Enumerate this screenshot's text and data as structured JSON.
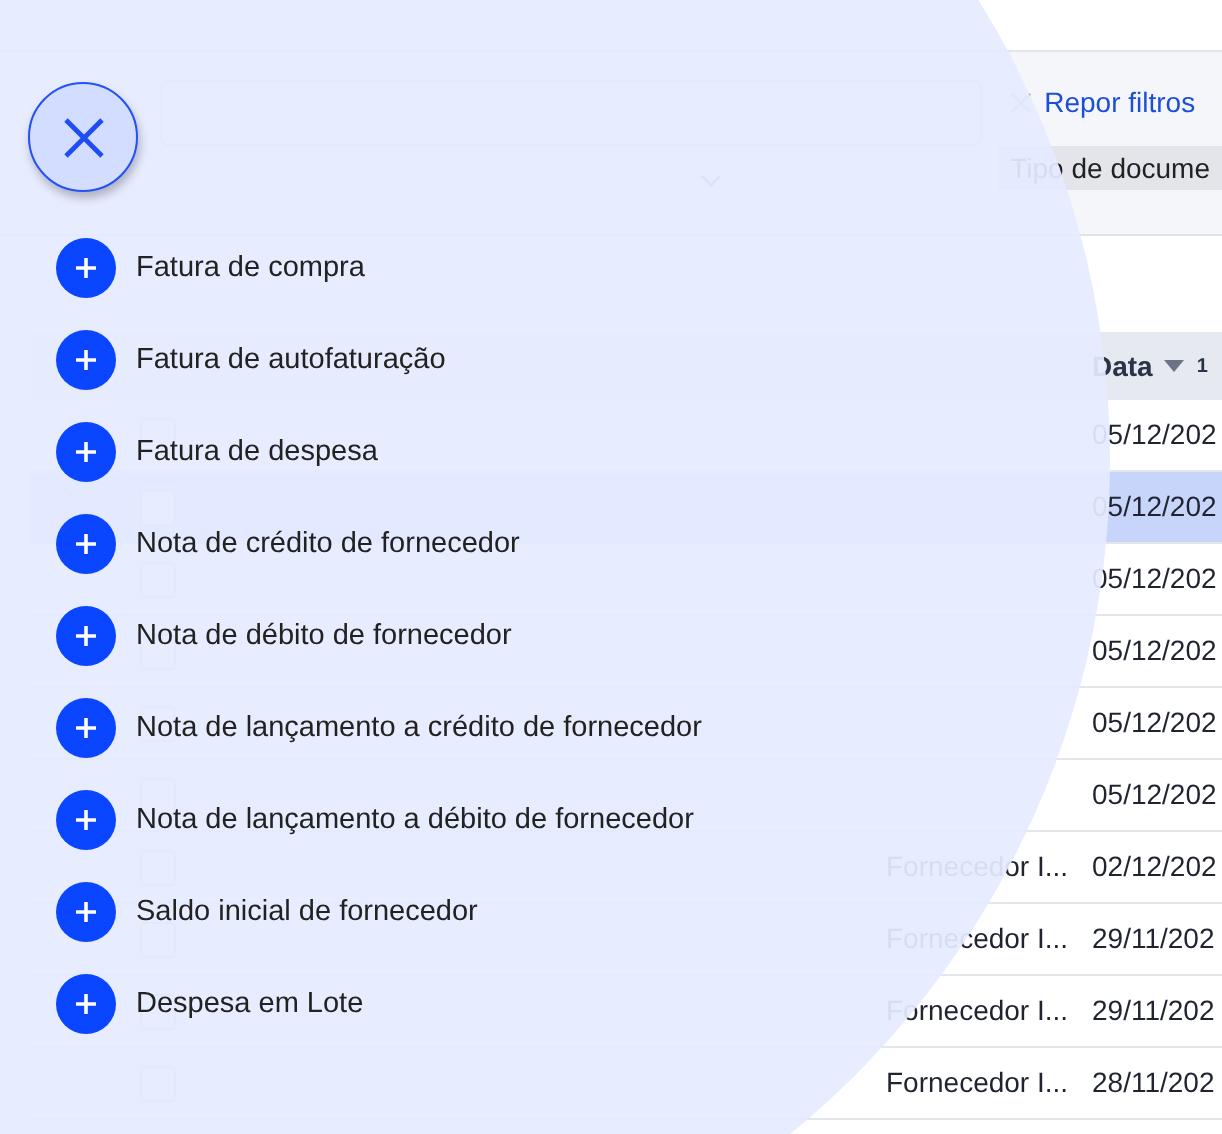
{
  "filters": {
    "reset": "Repor filtros",
    "document_type": "Tipo de docume"
  },
  "table": {
    "date_column": {
      "label": "Data",
      "sorted": true,
      "sort_rank": "1"
    },
    "rows": [
      {
        "date": "05/12/202",
        "selected": false
      },
      {
        "date": "05/12/202",
        "selected": true
      },
      {
        "date": "05/12/202",
        "selected": false
      },
      {
        "date": "05/12/202",
        "selected": false
      },
      {
        "date": "05/12/202",
        "selected": false
      },
      {
        "date": "05/12/202",
        "selected": false
      },
      {
        "supplier": "Fornecedor I...",
        "date": "02/12/202",
        "selected": false
      },
      {
        "supplier": "Fornecedor I...",
        "date": "29/11/202",
        "selected": false
      },
      {
        "supplier": "Fornecedor I...",
        "date": "29/11/202",
        "selected": false
      },
      {
        "supplier": "Fornecedor I...",
        "date": "28/11/202",
        "selected": false
      }
    ]
  },
  "menu": {
    "items": [
      "Fatura de compra",
      "Fatura de autofaturação",
      "Fatura de despesa",
      "Nota de crédito de fornecedor",
      "Nota de débito de fornecedor",
      "Nota de lançamento a crédito de fornecedor",
      "Nota de lançamento a débito de fornecedor",
      "Saldo inicial de fornecedor",
      "Despesa em Lote"
    ]
  }
}
